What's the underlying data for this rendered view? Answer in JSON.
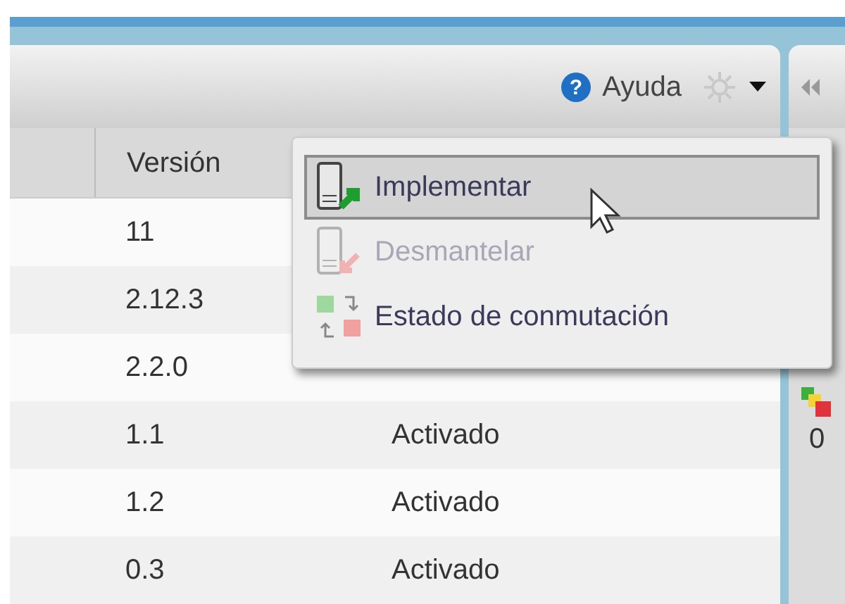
{
  "toolbar": {
    "help_icon": "?",
    "help_label": "Ayuda"
  },
  "table": {
    "columns": [
      "Versión"
    ],
    "rows": [
      {
        "version": "11"
      },
      {
        "version": "2.12.3"
      },
      {
        "version": "2.2.0"
      },
      {
        "version": "1.1",
        "state": "Activado"
      },
      {
        "version": "1.2",
        "state": "Activado"
      },
      {
        "version": "0.3",
        "state": "Activado"
      }
    ]
  },
  "menu": {
    "items": [
      {
        "label": "Implementar",
        "kind": "deploy",
        "selected": true,
        "disabled": false
      },
      {
        "label": "Desmantelar",
        "kind": "undeploy",
        "selected": false,
        "disabled": true
      },
      {
        "label": "Estado de conmutación",
        "kind": "toggle",
        "selected": false,
        "disabled": false
      }
    ]
  },
  "side_panel": {
    "count": "0"
  }
}
